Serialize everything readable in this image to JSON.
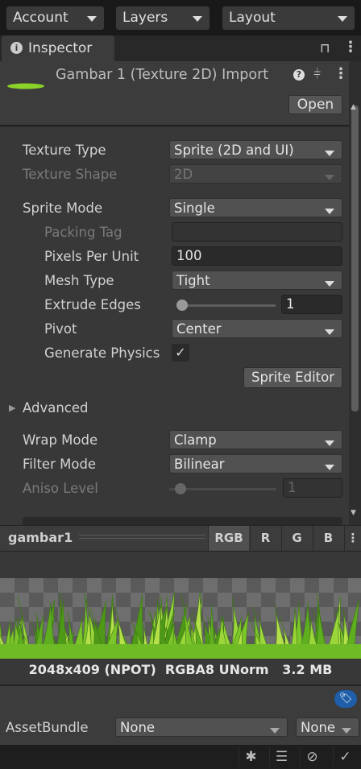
{
  "toolbar": {
    "account": "Account",
    "layers": "Layers",
    "layout": "Layout"
  },
  "inspector": {
    "tab_label": "Inspector",
    "title": "Gambar 1 (Texture 2D) Import",
    "open_button": "Open"
  },
  "settings": {
    "texture_type": {
      "label": "Texture Type",
      "value": "Sprite (2D and UI)"
    },
    "texture_shape": {
      "label": "Texture Shape",
      "value": "2D"
    },
    "sprite_mode": {
      "label": "Sprite Mode",
      "value": "Single"
    },
    "packing_tag": {
      "label": "Packing Tag",
      "value": ""
    },
    "pixels_per_unit": {
      "label": "Pixels Per Unit",
      "value": "100"
    },
    "mesh_type": {
      "label": "Mesh Type",
      "value": "Tight"
    },
    "extrude_edges": {
      "label": "Extrude Edges",
      "value": "1",
      "slider_fraction": 0.031
    },
    "pivot": {
      "label": "Pivot",
      "value": "Center"
    },
    "generate_physics": {
      "label": "Generate Physics",
      "checked": true
    },
    "sprite_editor": "Sprite Editor",
    "advanced": "Advanced",
    "wrap_mode": {
      "label": "Wrap Mode",
      "value": "Clamp"
    },
    "filter_mode": {
      "label": "Filter Mode",
      "value": "Bilinear"
    },
    "aniso_level": {
      "label": "Aniso Level",
      "value": "1",
      "slider_fraction": 0.0625
    }
  },
  "preview": {
    "name": "gambar1",
    "channels": [
      "RGB",
      "R",
      "G",
      "B"
    ],
    "active_channel": "RGB",
    "info": "2048x409 (NPOT)  RGBA8 UNorm   3.2 MB"
  },
  "asset_bundle": {
    "label": "AssetBundle",
    "name": "None",
    "variant": "None"
  },
  "colors": {
    "grass": "#7cc52a",
    "tag_badge": "#1f5ea8",
    "bg": "#383838"
  }
}
